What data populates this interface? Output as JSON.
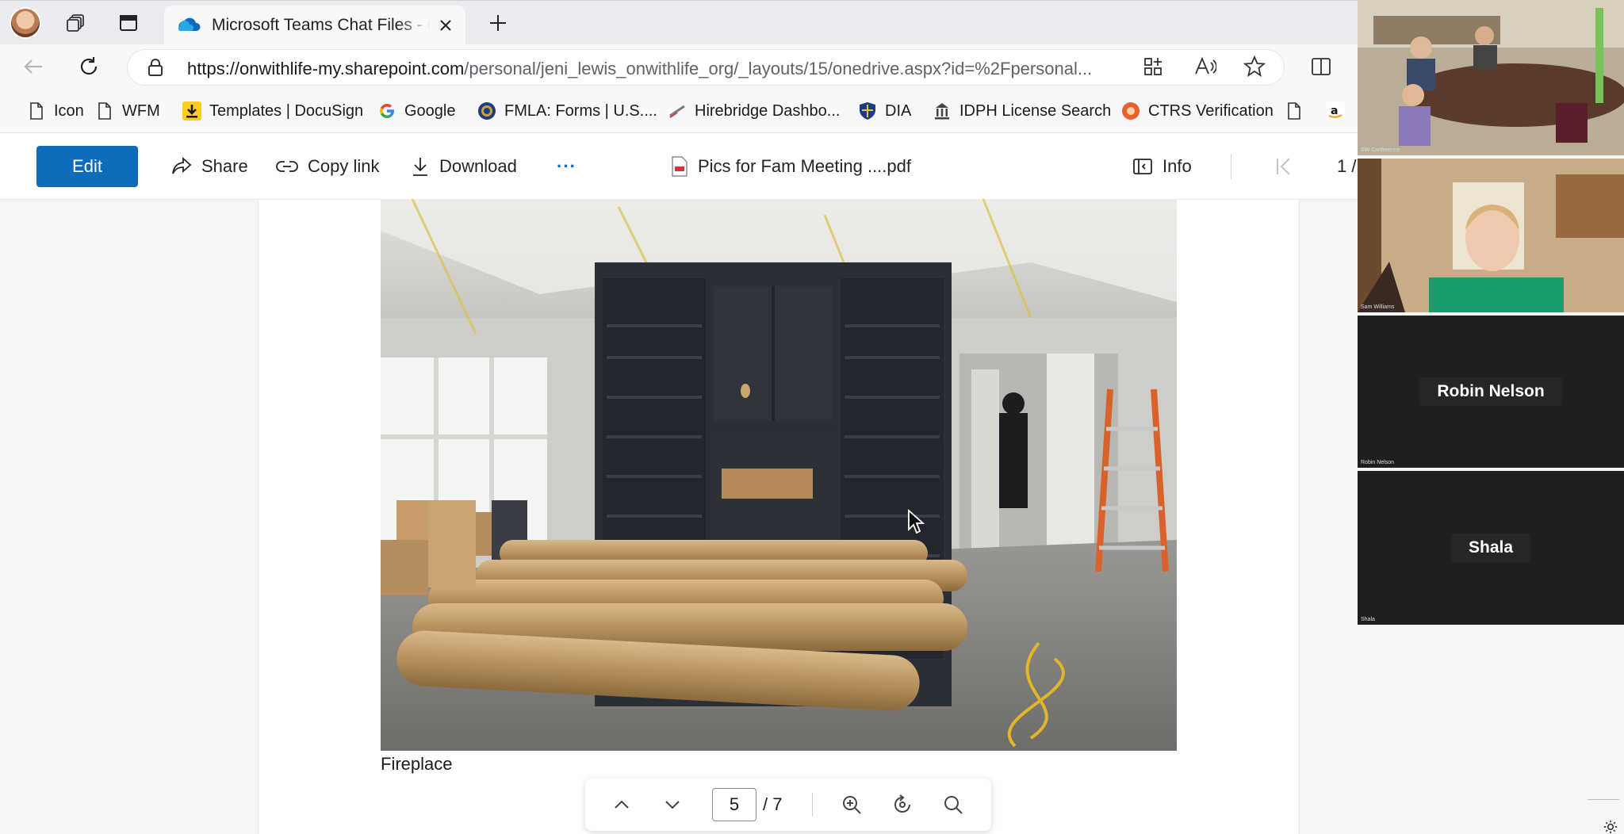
{
  "browser": {
    "tab": {
      "title": "Microsoft Teams Chat Files - OneDrive"
    },
    "address": {
      "url_domain": "https://onwithlife-my.sharepoint.com",
      "url_path": "/personal/jeni_lewis_onwithlife_org/_layouts/15/onedrive.aspx?id=%2Fpersonal..."
    },
    "favorites": [
      {
        "label": "Icon",
        "icon": "page-icon"
      },
      {
        "label": "WFM",
        "icon": "page-icon"
      },
      {
        "label": "Templates | DocuSign",
        "icon": "docusign-icon"
      },
      {
        "label": "Google",
        "icon": "google-icon"
      },
      {
        "label": "FMLA: Forms | U.S....",
        "icon": "dol-seal-icon"
      },
      {
        "label": "Hirebridge Dashbo...",
        "icon": "hirebridge-icon"
      },
      {
        "label": "DIA",
        "icon": "shield-icon"
      },
      {
        "label": "IDPH License Search",
        "icon": "capitol-icon"
      },
      {
        "label": "CTRS Verification",
        "icon": "ctrs-icon"
      }
    ]
  },
  "toolbar": {
    "edit_label": "Edit",
    "share_label": "Share",
    "copy_link_label": "Copy link",
    "download_label": "Download",
    "more_label": "···",
    "file_name": "Pics for Fam Meeting ....pdf",
    "info_label": "Info",
    "page_indicator": "1 /"
  },
  "document": {
    "caption": "Fireplace",
    "current_page": "5",
    "total_pages": "/ 7"
  },
  "meeting": {
    "tiles": [
      {
        "name": "SW Conference",
        "kind": "video-room"
      },
      {
        "name": "Sam Williams",
        "kind": "video-person"
      },
      {
        "name": "Robin Nelson",
        "kind": "avatar"
      },
      {
        "name": "Shala",
        "kind": "avatar"
      }
    ]
  },
  "colors": {
    "accent": "#0f6cbd",
    "tile_bg": "#1f1f1f"
  }
}
